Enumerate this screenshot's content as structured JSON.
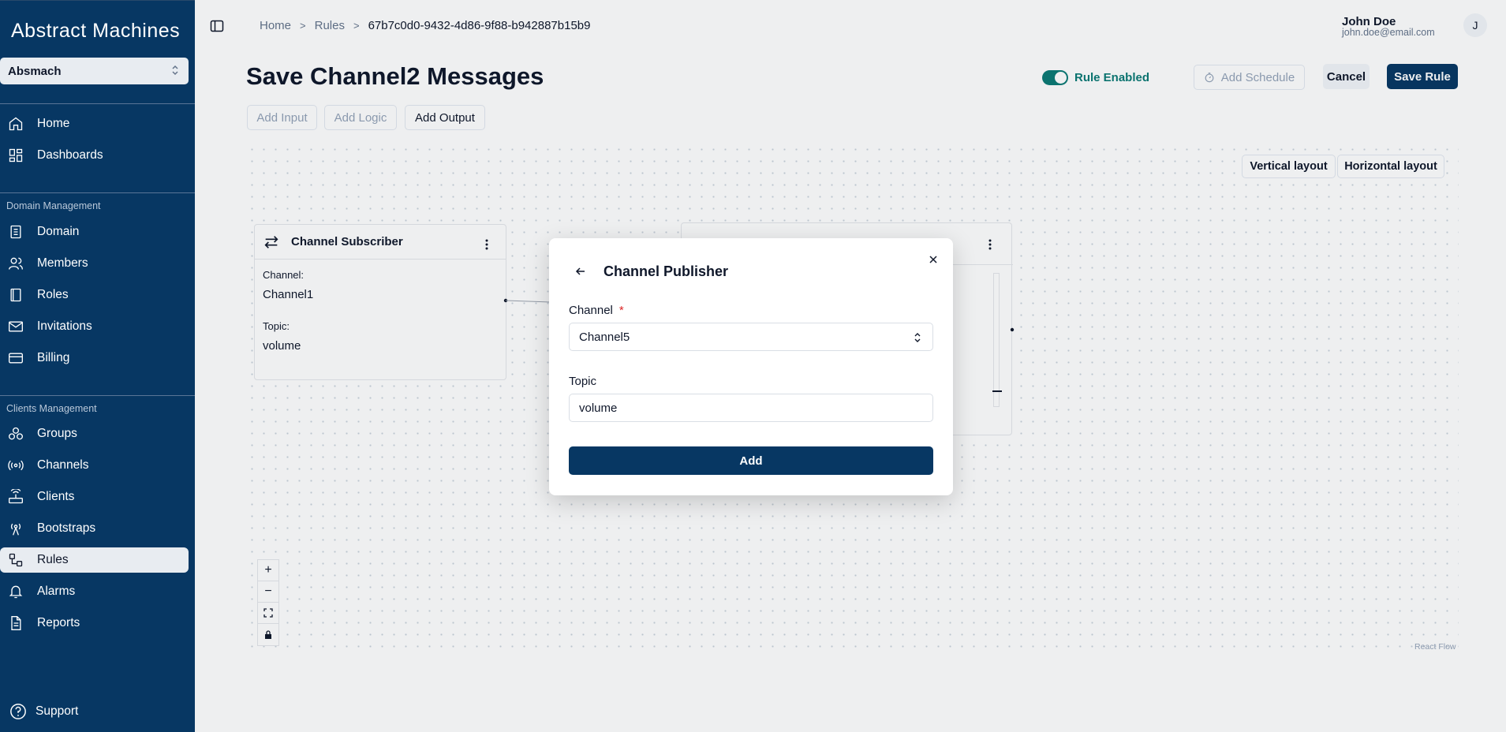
{
  "app": {
    "logo_text": "Abstract Machines"
  },
  "sidebar": {
    "org": "Absmach",
    "items_top": [
      {
        "label": "Home",
        "icon": "home-icon"
      },
      {
        "label": "Dashboards",
        "icon": "dashboard-icon"
      }
    ],
    "domain_section": "Domain Management",
    "domain_items": [
      {
        "label": "Domain",
        "icon": "building-icon"
      },
      {
        "label": "Members",
        "icon": "users-icon"
      },
      {
        "label": "Roles",
        "icon": "book-icon"
      },
      {
        "label": "Invitations",
        "icon": "mail-icon"
      },
      {
        "label": "Billing",
        "icon": "credit-card-icon"
      }
    ],
    "clients_section": "Clients Management",
    "clients_items": [
      {
        "label": "Groups",
        "icon": "groups-icon"
      },
      {
        "label": "Channels",
        "icon": "radio-icon"
      },
      {
        "label": "Clients",
        "icon": "router-icon"
      },
      {
        "label": "Bootstraps",
        "icon": "antenna-icon"
      },
      {
        "label": "Rules",
        "icon": "workflow-icon",
        "active": true
      },
      {
        "label": "Alarms",
        "icon": "bell-icon"
      },
      {
        "label": "Reports",
        "icon": "file-icon"
      }
    ],
    "support": "Support"
  },
  "breadcrumb": {
    "home": "Home",
    "rules": "Rules",
    "current": "67b7c0d0-9432-4d86-9f88-b942887b15b9"
  },
  "user": {
    "name": "John Doe",
    "email": "john.doe@email.com",
    "initial": "J"
  },
  "page": {
    "title": "Save Channel2 Messages",
    "rule_enabled_label": "Rule Enabled",
    "add_schedule": "Add Schedule",
    "cancel": "Cancel",
    "save_rule": "Save Rule",
    "add_input": "Add Input",
    "add_logic": "Add Logic",
    "add_output": "Add Output"
  },
  "canvas": {
    "vertical_layout": "Vertical layout",
    "horizontal_layout": "Horizontal layout",
    "attribution": "React Flow",
    "node": {
      "title": "Channel Subscriber",
      "channel_label": "Channel:",
      "channel_value": "Channel1",
      "topic_label": "Topic:",
      "topic_value": "volume"
    },
    "zoom": {
      "in": "+",
      "out": "−"
    }
  },
  "modal": {
    "title": "Channel Publisher",
    "channel_label": "Channel",
    "required_mark": "*",
    "channel_value": "Channel5",
    "topic_label": "Topic",
    "topic_value": "volume",
    "add": "Add"
  },
  "colors": {
    "sidebar_bg": "#073763",
    "accent_teal": "#0b7a75",
    "primary": "#073763",
    "required": "#dc2626"
  }
}
